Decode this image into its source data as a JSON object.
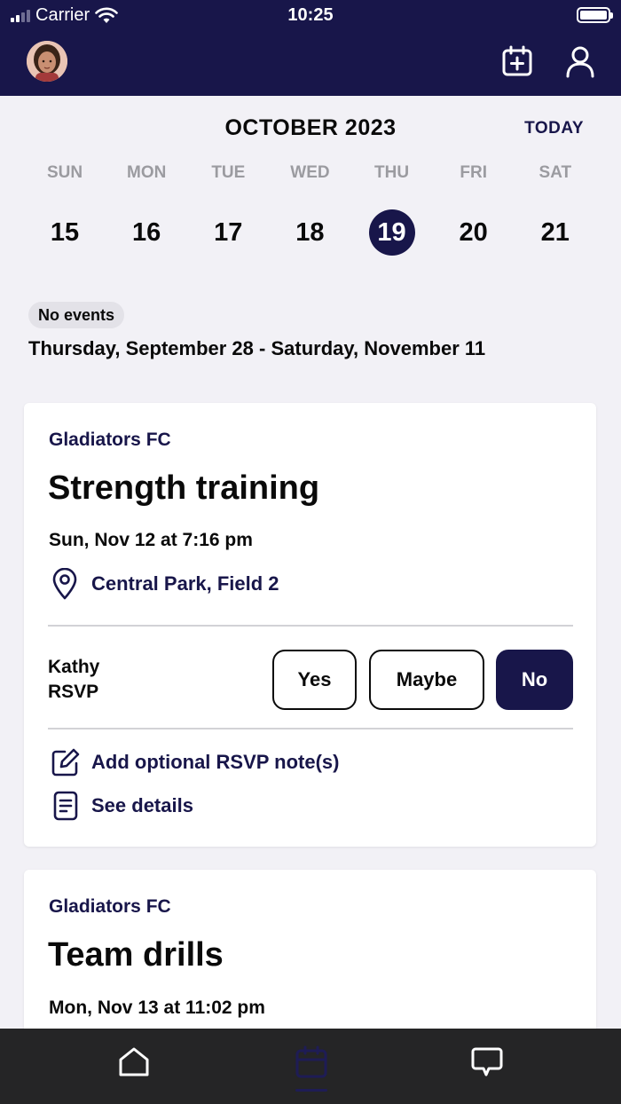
{
  "status_bar": {
    "carrier": "Carrier",
    "time": "10:25"
  },
  "header": {
    "avatar_icon": "user-photo",
    "add_event_icon": "calendar-plus-icon",
    "profile_icon": "person-icon"
  },
  "calendar": {
    "month": "OCTOBER 2023",
    "today_label": "TODAY",
    "days": [
      {
        "dow": "SUN",
        "num": "15"
      },
      {
        "dow": "MON",
        "num": "16"
      },
      {
        "dow": "TUE",
        "num": "17"
      },
      {
        "dow": "WED",
        "num": "18"
      },
      {
        "dow": "THU",
        "num": "19",
        "selected": true
      },
      {
        "dow": "FRI",
        "num": "20"
      },
      {
        "dow": "SAT",
        "num": "21"
      }
    ]
  },
  "events_info": {
    "badge": "No events",
    "range": "Thursday, September 28 - Saturday, November 11"
  },
  "events": [
    {
      "team": "Gladiators FC",
      "title": "Strength training",
      "when": "Sun, Nov 12 at 7:16 pm",
      "location": "Central Park, Field 2",
      "rsvp_name_line1": "Kathy",
      "rsvp_name_line2": "RSVP",
      "rsvp_options": [
        "Yes",
        "Maybe",
        "No"
      ],
      "rsvp_selected": "No",
      "note_link": "Add optional RSVP note(s)",
      "details_link": "See details"
    },
    {
      "team": "Gladiators FC",
      "title": "Team drills",
      "when": "Mon, Nov 13 at 11:02 pm"
    }
  ],
  "tabbar": {
    "tabs": [
      "home-icon",
      "calendar-icon",
      "chat-icon"
    ],
    "active": "calendar-icon"
  },
  "colors": {
    "brand": "#18164a",
    "background": "#f2f1f6",
    "tabbar": "#252526"
  }
}
